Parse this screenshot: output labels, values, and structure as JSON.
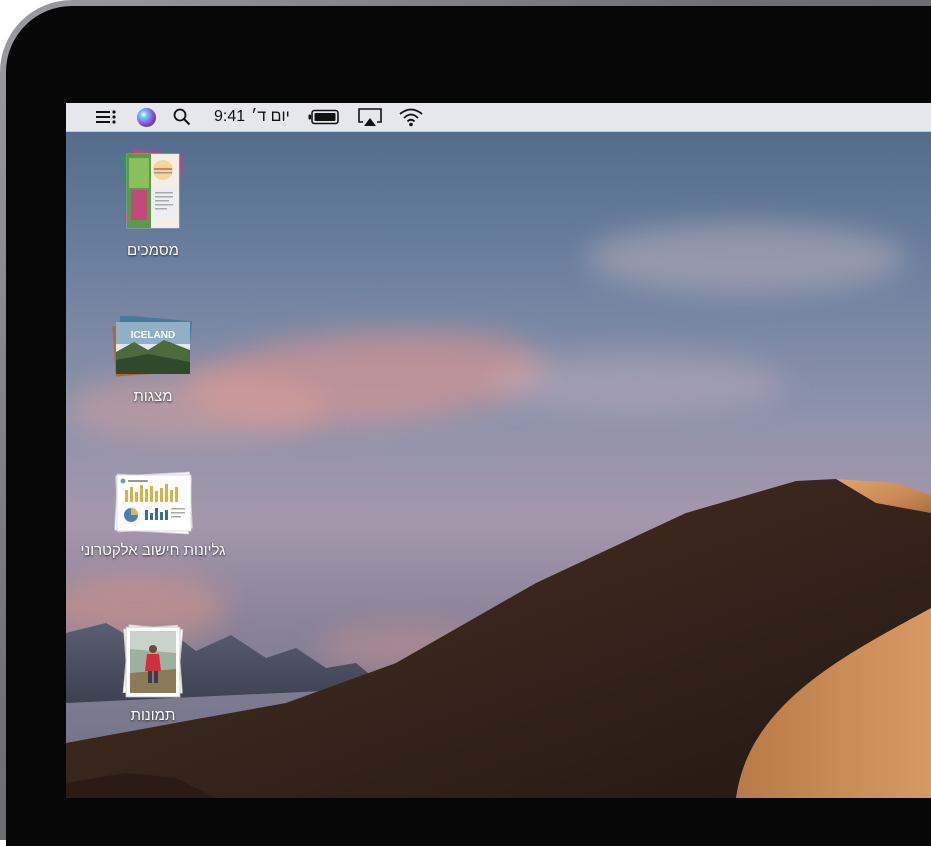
{
  "menubar": {
    "clock_time": "9:41",
    "clock_day": "יום ד׳",
    "icons": [
      "list-icon",
      "siri-icon",
      "search-icon",
      "battery-icon",
      "airplay-icon",
      "wifi-icon"
    ]
  },
  "desktop": {
    "stacks": [
      {
        "label": "מסמכים",
        "icon": "documents-stack-icon"
      },
      {
        "label": "מצגות",
        "icon": "presentations-stack-icon",
        "thumb_text": "ICELAND"
      },
      {
        "label": "גליונות חישוב אלקטרוני",
        "icon": "spreadsheets-stack-icon"
      },
      {
        "label": "תמונות",
        "icon": "photos-stack-icon"
      }
    ]
  },
  "colors": {
    "menubar_bg": "#ECECF0",
    "bezel": "#060606",
    "sky_top": "#4F6787",
    "dune_dark": "#2E2019",
    "dune_light": "#C98A55"
  }
}
